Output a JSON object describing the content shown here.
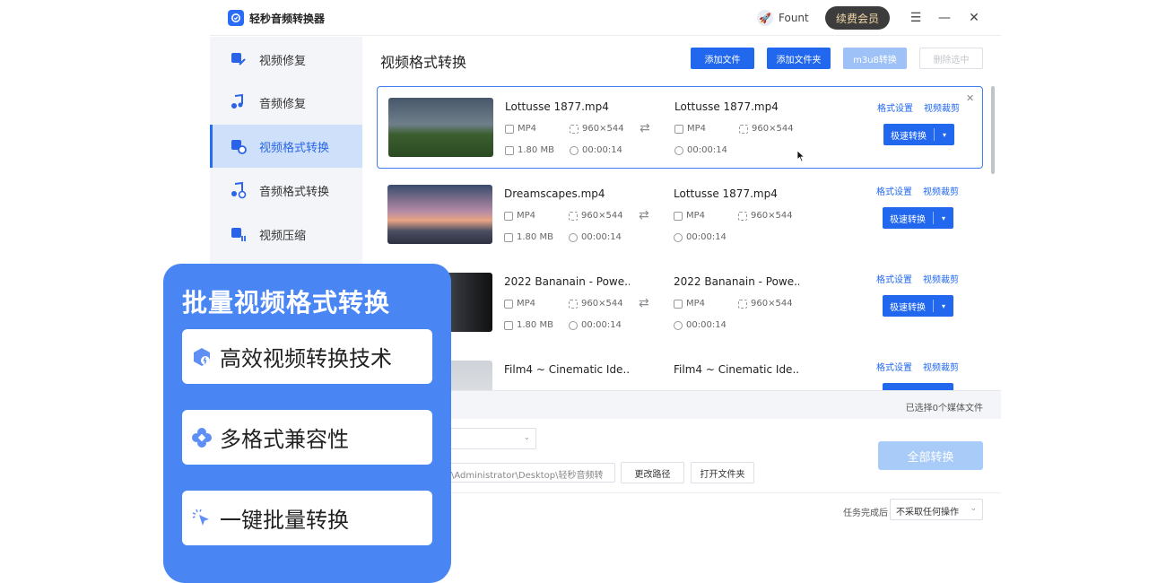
{
  "app": {
    "name": "轻秒音频转换器",
    "user": "Fount",
    "vip_button": "续费会员"
  },
  "sidebar": {
    "items": [
      {
        "label": "视频修复",
        "icon": "video-repair-icon"
      },
      {
        "label": "音频修复",
        "icon": "audio-repair-icon"
      },
      {
        "label": "视频格式转换",
        "icon": "video-convert-icon",
        "active": true
      },
      {
        "label": "音频格式转换",
        "icon": "audio-convert-icon"
      },
      {
        "label": "视频压缩",
        "icon": "video-compress-icon"
      }
    ]
  },
  "main": {
    "title": "视频格式转换",
    "buttons": {
      "add_file": "添加文件",
      "add_folder": "添加文件夹",
      "m3u8": "m3u8转换",
      "delete_selected": "删除选中"
    }
  },
  "files": [
    {
      "name": "Lottusse 1877.mp4",
      "format": "MP4",
      "resolution": "960×544",
      "size": "1.80 MB",
      "duration": "00:00:14",
      "out_name": "Lottusse 1877.mp4",
      "out_format": "MP4",
      "out_resolution": "960×544",
      "out_duration": "00:00:14",
      "selected": true
    },
    {
      "name": "Dreamscapes.mp4",
      "format": "MP4",
      "resolution": "960×544",
      "size": "1.80 MB",
      "duration": "00:00:14",
      "out_name": "Lottusse 1877.mp4",
      "out_format": "MP4",
      "out_resolution": "960×544",
      "out_duration": "00:00:14"
    },
    {
      "name": "2022 Bananain - Powe...",
      "format": "MP4",
      "resolution": "960×544",
      "size": "1.80 MB",
      "duration": "00:00:14",
      "out_name": "2022 Bananain - Powe...",
      "out_format": "MP4",
      "out_resolution": "960×544",
      "out_duration": "00:00:14"
    },
    {
      "name": "Film4 ~ Cinematic Ide...",
      "out_name": "Film4 ~ Cinematic Ide..."
    }
  ],
  "row_actions": {
    "format_settings": "格式设置",
    "video_crop": "视频裁剪",
    "fast_convert": "极速转换"
  },
  "status": {
    "selected_text": "已选择0个媒体文件"
  },
  "output": {
    "path": "Users\\Administrator\\Desktop\\轻秒音频转",
    "change_path": "更改路径",
    "open_folder": "打开文件夹",
    "convert_all": "全部转换"
  },
  "after_task": {
    "label": "任务完成后",
    "value": "不采取任何操作"
  },
  "promo": {
    "title": "批量视频格式转换",
    "features": [
      {
        "text": "高效视频转换技术",
        "icon": "speed-cube-icon"
      },
      {
        "text": "多格式兼容性",
        "icon": "clover-icon"
      },
      {
        "text": "一键批量转换",
        "icon": "click-cursor-icon"
      }
    ]
  },
  "colors": {
    "primary": "#2268ef",
    "promo": "#4a86f3",
    "active_nav_bg": "#cfe0fb"
  }
}
